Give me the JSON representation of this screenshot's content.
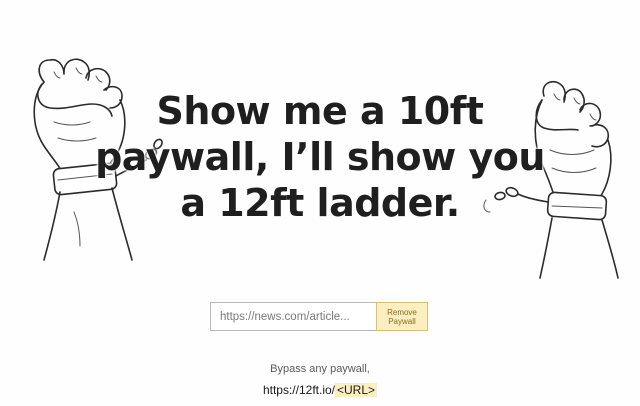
{
  "headline": {
    "line1": "Show me a 10ft",
    "line2": "paywall, I’ll show you",
    "line3": "a 12ft ladder."
  },
  "form": {
    "url_placeholder": "https://news.com/article...",
    "submit_line1": "Remove",
    "submit_line2": "Paywall"
  },
  "footer": {
    "tagline": "Bypass any paywall,",
    "usage_prefix": "https://12ft.io/",
    "usage_tag": "<URL>"
  },
  "icons": {
    "left": "raised-fist-broken-shackle-icon",
    "right": "raised-fist-broken-shackle-icon"
  },
  "colors": {
    "button_bg": "#fbeec1",
    "button_border": "#d9c173",
    "text_dark": "#1f1f1f"
  }
}
